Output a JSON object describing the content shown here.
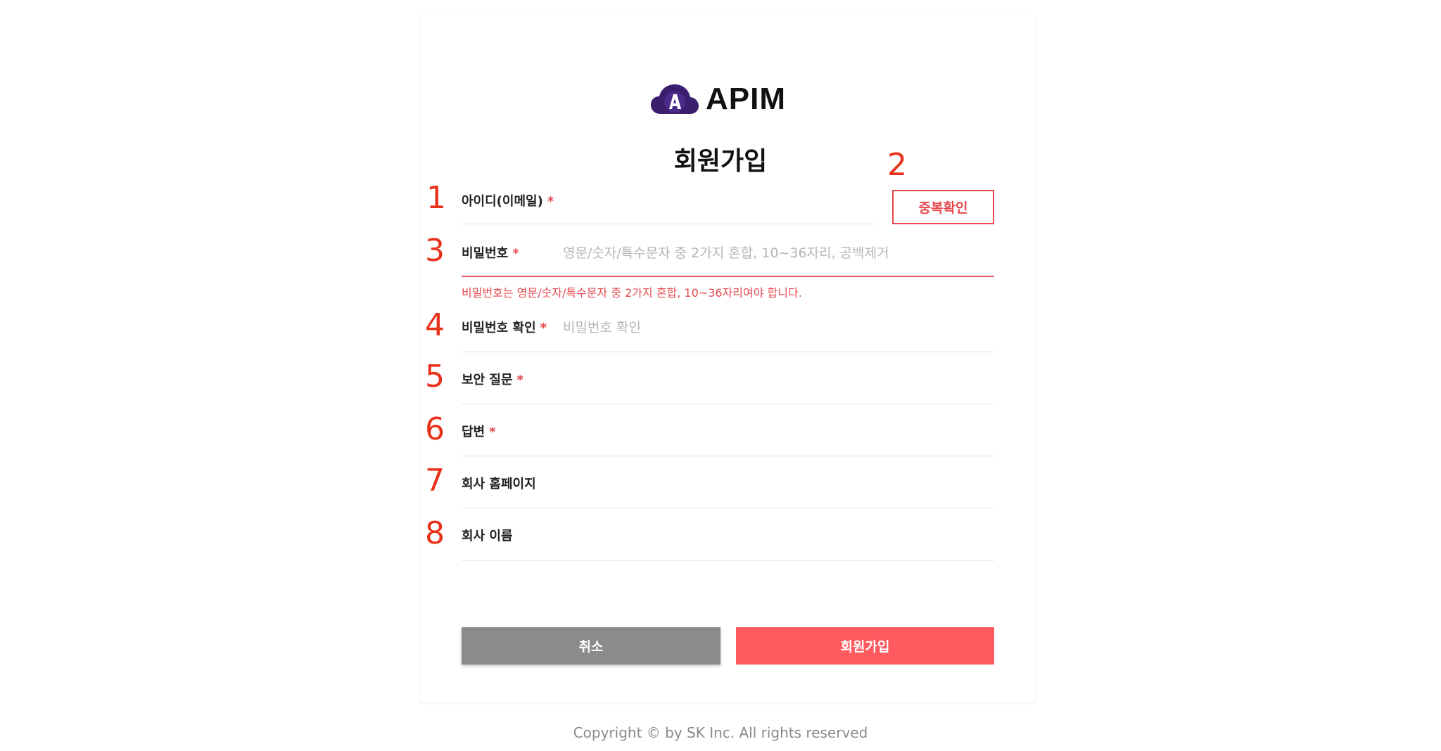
{
  "brand": {
    "name": "APIM",
    "icon": "apim-cloud-logo-icon",
    "color": "#3b1f6e"
  },
  "page": {
    "title": "회원가입"
  },
  "annotations": [
    "1",
    "2",
    "3",
    "4",
    "5",
    "6",
    "7",
    "8"
  ],
  "fields": {
    "id": {
      "label": "아이디(이메일)",
      "required": "*",
      "value": "",
      "placeholder": ""
    },
    "password": {
      "label": "비밀번호",
      "required": "*",
      "value": "",
      "placeholder": "영문/숫자/특수문자 중 2가지 혼합, 10~36자리, 공백제거",
      "error": "비밀번호는 영문/숫자/특수문자 중 2가지 혼합, 10~36자리여야 합니다."
    },
    "password_confirm": {
      "label": "비밀번호 확인",
      "required": "*",
      "value": "",
      "placeholder": "비밀번호 확인"
    },
    "security_question": {
      "label": "보안 질문",
      "required": "*",
      "value": ""
    },
    "answer": {
      "label": "답변",
      "required": "*",
      "value": ""
    },
    "company_homepage": {
      "label": "회사 홈페이지",
      "value": ""
    },
    "company_name": {
      "label": "회사 이름",
      "value": ""
    }
  },
  "buttons": {
    "duplicate_check": "중복확인",
    "cancel": "취소",
    "signup": "회원가입"
  },
  "footer": {
    "copyright": "Copyright © by SK Inc. All rights reserved"
  },
  "colors": {
    "accent": "#ff5a5f",
    "error": "#e5484d",
    "annotation": "#e8311a",
    "cancel": "#8b8b8b"
  }
}
